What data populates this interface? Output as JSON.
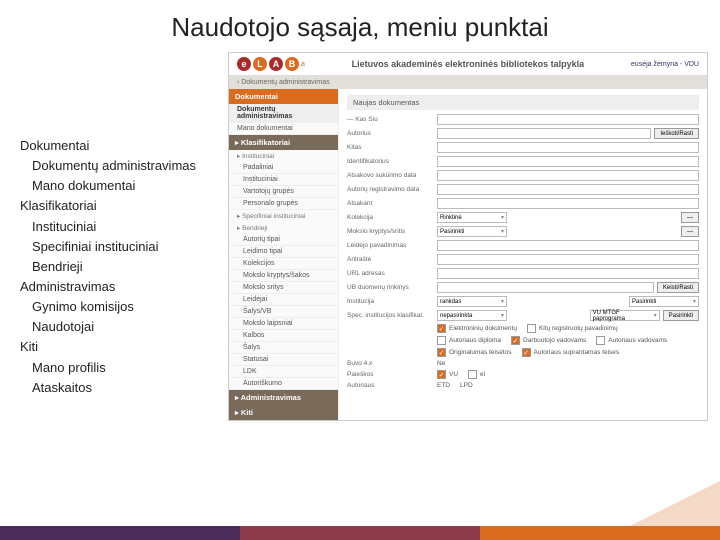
{
  "slide_title": "Naudotojo sąsaja, meniu punktai",
  "overlay": [
    {
      "t": "Dokumentai",
      "l": 0
    },
    {
      "t": "Dokumentų administravimas",
      "l": 1
    },
    {
      "t": "Mano dokumentai",
      "l": 1
    },
    {
      "t": "Klasifikatoriai",
      "l": 0
    },
    {
      "t": "Instituciniai",
      "l": 1
    },
    {
      "t": "Specifiniai instituciniai",
      "l": 1
    },
    {
      "t": "Bendrieji",
      "l": 1
    },
    {
      "t": "Administravimas",
      "l": 0
    },
    {
      "t": "Gynimo komisijos",
      "l": 1
    },
    {
      "t": "Naudotojai",
      "l": 1
    },
    {
      "t": "Kiti",
      "l": 0
    },
    {
      "t": "Mano profilis",
      "l": 1
    },
    {
      "t": "Ataskaitos",
      "l": 1
    }
  ],
  "brand": "Lietuvos akademinės elektroninės bibliotekos talpykla",
  "user": "eusėja žemyna - VDU",
  "breadcrumb": "› Dokumentų administravimas",
  "sidebar": {
    "doc_header": "Dokumentai",
    "doc_items": [
      "Dokumentų administravimas",
      "Mano dokumentai"
    ],
    "klas_header": "▸ Klasifikatoriai",
    "klas_groups": [
      {
        "g": "Instituciniai",
        "items": [
          "Padaliniai",
          "Instituciniai",
          "Vartotojų grupės",
          "Personalo grupės"
        ]
      },
      {
        "g": "Specifiniai instituciniai",
        "items": []
      },
      {
        "g": "Bendrieji",
        "items": [
          "Autorių tipai",
          "Leidimo tipai",
          "Kolekcijos",
          "Mokslo kryptys/šakos",
          "Mokslo sritys",
          "Leidėjai",
          "Šalys/VB",
          "Mokslo laipsniai",
          "Kalbos",
          "Šalys",
          "Statusai",
          "LDK",
          "Autoriškumo"
        ]
      }
    ],
    "admin_header": "▸ Administravimas",
    "kiti_header": "▸ Kiti"
  },
  "panel_title": "Naujas dokumentas",
  "fields": [
    {
      "label": "— Kas Siu",
      "type": "text"
    },
    {
      "label": "Autorius",
      "type": "text_btn",
      "btn": "Ieškoti/Rasti"
    },
    {
      "label": "Kitas",
      "type": "text"
    },
    {
      "label": "Identifikatorius",
      "type": "text"
    },
    {
      "label": "Atsakovo sukūrimo data",
      "type": "text"
    },
    {
      "label": "Autorių registravimo data",
      "type": "text"
    },
    {
      "label": "Atsakant",
      "type": "text"
    },
    {
      "label": "Kolekcija",
      "type": "sel_btn",
      "sel": "Rinktinė",
      "btn": "—"
    },
    {
      "label": "Mokslo kryptys/sritis",
      "type": "sel_btn",
      "sel": "Pasirinkti",
      "btn": "—"
    },
    {
      "label": "Leidėjo pavadinimas",
      "type": "text"
    },
    {
      "label": "Antraštė",
      "type": "text"
    },
    {
      "label": "URL adresas",
      "type": "text"
    },
    {
      "label": "UB duomenų rinkinys",
      "type": "text_btn",
      "btn": "Keisti/Rasti"
    },
    {
      "label": "Institucija",
      "type": "two_sel",
      "sel1": "rankdas",
      "sel2": "Pasirinkti"
    },
    {
      "label": "Spec. institucijos klasifikat.",
      "type": "two_sel_btn",
      "sel1": "nepasirinkta",
      "sel2": "VU MTGF paprograma",
      "btn": "Pasirinkti"
    }
  ],
  "cb_rows": [
    [
      {
        "c": true,
        "t": "Elektroninių dokumentų"
      },
      {
        "c": false,
        "t": "Kitų registruotų pavadinimų"
      }
    ],
    [
      {
        "c": false,
        "t": "Autoriaus diploma"
      },
      {
        "c": true,
        "t": "Darbuotojo vadovams"
      },
      {
        "c": false,
        "t": "Autoriaus vadovams"
      }
    ],
    [
      {
        "c": true,
        "t": "Originalumas teisėtos"
      },
      {
        "c": true,
        "t": "Autoriaus suprantamas teises"
      }
    ]
  ],
  "bool_row": {
    "label": "Buvo 4.x",
    "v": "Ne"
  },
  "final_row": {
    "label": "Paieškos",
    "cbs": [
      {
        "c": true,
        "t": "VU"
      },
      {
        "c": false,
        "t": "el"
      }
    ]
  },
  "last_row": {
    "label": "Autoriaus",
    "items": [
      "ETD",
      "LPD"
    ]
  }
}
